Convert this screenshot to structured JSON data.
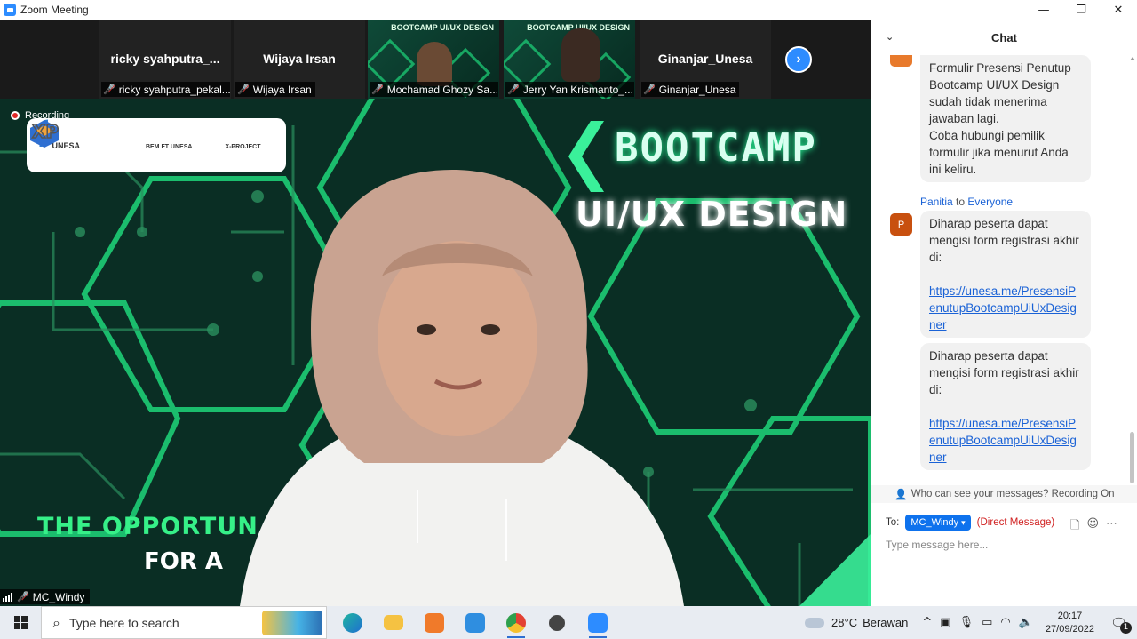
{
  "window": {
    "title": "Zoom Meeting",
    "controls": {
      "minimize": "—",
      "maximize": "❐",
      "close": "✕"
    }
  },
  "participants": [
    {
      "tile_name": "ricky  syahputra_...",
      "label": "ricky syahputra_pekal...",
      "video": false
    },
    {
      "tile_name": "Wijaya Irsan",
      "label": "Wijaya Irsan",
      "video": false
    },
    {
      "tile_name": "",
      "label": "Mochamad Ghozy Sa...",
      "video": true,
      "video_text": "BOOTCAMP UI/UX DESIGN"
    },
    {
      "tile_name": "",
      "label": "Jerry Yan Krismanto_...",
      "video": true,
      "video_text": "BOOTCAMP UI/UX DESIGN"
    },
    {
      "tile_name": "Ginanjar_Unesa",
      "label": "Ginanjar_Unesa",
      "video": false
    }
  ],
  "next_page_icon": "chevron-right-icon",
  "stage": {
    "recording": "Recording",
    "logos": [
      {
        "name": "unesa-logo",
        "text": "UNESA"
      },
      {
        "name": "informatika-logo",
        "text": ""
      },
      {
        "name": "ukm-logo",
        "text": "BEM FT UNESA"
      },
      {
        "name": "x-project-logo",
        "text": "X-PROJECT"
      }
    ],
    "headline": "BOOTCAMP",
    "subheadline": "UI/UX DESIGN",
    "tagline_1": "THE OPPORTUN",
    "tagline_2": "FOR A",
    "speaker": "MC_Windy",
    "accent": "#1ed67a",
    "background": "#0a2e24"
  },
  "chat": {
    "title": "Chat",
    "messages": [
      {
        "sender": "",
        "to": "",
        "text": "Formulir Presensi Penutup Bootcamp UI/UX Design sudah tidak menerima jawaban lagi.\nCoba hubungi pemilik formulir jika menurut Anda ini keliru."
      },
      {
        "sender": "Panitia",
        "to_word": "to",
        "to": "Everyone",
        "avatar": "P",
        "text": "Diharap peserta dapat mengisi form registrasi akhir di:",
        "link": "https://unesa.me/PresensiPenutupBootcampUiUxDesigner"
      },
      {
        "sender": "",
        "to": "",
        "text": "Diharap peserta dapat mengisi form registrasi akhir di:",
        "link": "https://unesa.me/PresensiPenutupBootcampUiUxDesigner"
      }
    ],
    "visibility": "Who can see your messages? Recording On",
    "to_label": "To:",
    "recipient": "MC_Windy",
    "direct": "(Direct Message)",
    "input_placeholder": "Type message here..."
  },
  "taskbar": {
    "search_placeholder": "Type here to search",
    "apps": [
      "edge-icon",
      "file-explorer-icon",
      "xampp-icon",
      "vscode-icon",
      "chrome-icon",
      "settings-icon",
      "zoom-icon"
    ],
    "weather_temp": "28°C",
    "weather_text": "Berawan",
    "time": "20:17",
    "date": "27/09/2022",
    "notifications": "1"
  }
}
